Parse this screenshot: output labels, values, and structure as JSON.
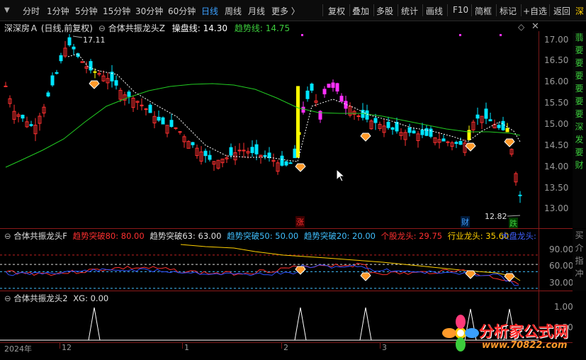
{
  "toolbar": {
    "periods": [
      "分时",
      "1分钟",
      "5分钟",
      "15分钟",
      "30分钟",
      "60分钟",
      "日线",
      "周线",
      "月线",
      "更多 〉"
    ],
    "active_period": "日线",
    "actions": [
      "复权",
      "叠加",
      "多股",
      "统计",
      "画线",
      "F10",
      "简框",
      "标记",
      "+自选",
      "返回"
    ],
    "right_edge_label": "深"
  },
  "main_panel": {
    "title": "深深房Ａ (日线,前复权)",
    "indicator_name": "合体共振龙头Z",
    "line1_label": "操盘线:",
    "line1_value": "14.30",
    "line2_label": "趋势线:",
    "line2_value": "14.75",
    "high_label": "17.11",
    "low_label": "12.82",
    "marker_zhang": "涨",
    "marker_cai": "财",
    "marker_die": "跌",
    "price_ticks": [
      "17.00",
      "16.50",
      "16.00",
      "15.50",
      "15.00",
      "14.50",
      "14.00",
      "13.50",
      "13.00"
    ],
    "right_strip": [
      "翡",
      "要",
      "要",
      "要",
      "要",
      "要",
      "要",
      "深",
      "发",
      "要",
      "财"
    ]
  },
  "sub_panel_1": {
    "title": "合体共振龙头F",
    "items": [
      {
        "label": "趋势突破80:",
        "value": "80.00",
        "color": "#ff3030"
      },
      {
        "label": "趋势突破63:",
        "value": "63.00",
        "color": "#e0e0e0"
      },
      {
        "label": "趋势突破50:",
        "value": "50.00",
        "color": "#40c0ff"
      },
      {
        "label": "趋势突破20:",
        "value": "20.00",
        "color": "#40c0ff"
      },
      {
        "label": "个股龙头:",
        "value": "29.75",
        "color": "#ff3030"
      },
      {
        "label": "行业龙头:",
        "value": "35.60",
        "color": "#ffd000"
      },
      {
        "label": "大盘龙头:",
        "value": "",
        "color": "#4060ff"
      }
    ],
    "ticks": [
      "90.00",
      "60.00",
      "30.00"
    ],
    "right_strip": [
      "买",
      "介",
      "指",
      "冲"
    ]
  },
  "sub_panel_2": {
    "title": "合体共振龙头2",
    "xg_label": "XG:",
    "xg_value": "0.00",
    "ticks": [
      "1.00",
      "0.50"
    ]
  },
  "time_axis": {
    "labels": [
      "2024年",
      "12",
      "1",
      "2",
      "3"
    ]
  },
  "watermark": {
    "brand": "分析家公式网",
    "url": "www.70822.com"
  },
  "chart_data": {
    "type": "candlestick",
    "price_range": [
      12.8,
      17.2
    ],
    "overlay_lines": [
      {
        "name": "操盘线",
        "value": 14.3
      },
      {
        "name": "趋势线",
        "value": 14.75
      }
    ],
    "high": 17.11,
    "low": 12.82
  }
}
